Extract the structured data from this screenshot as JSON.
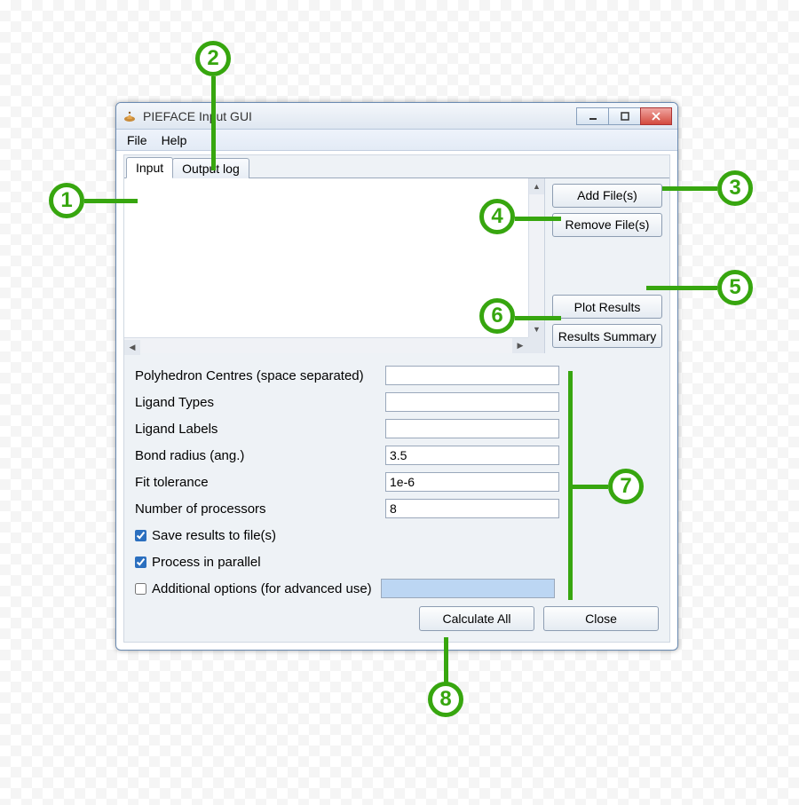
{
  "window": {
    "title": "PIEFACE Input GUI"
  },
  "menubar": {
    "file": "File",
    "help": "Help"
  },
  "tabs": {
    "input": "Input",
    "output_log": "Output log"
  },
  "sidebuttons": {
    "add_files": "Add File(s)",
    "remove_files": "Remove File(s)",
    "plot_results": "Plot Results",
    "results_summary": "Results Summary"
  },
  "form": {
    "poly_centres_label": "Polyhedron Centres (space separated)",
    "poly_centres_value": "",
    "ligand_types_label": "Ligand Types",
    "ligand_types_value": "",
    "ligand_labels_label": "Ligand Labels",
    "ligand_labels_value": "",
    "bond_radius_label": "Bond radius (ang.)",
    "bond_radius_value": "3.5",
    "fit_tol_label": "Fit tolerance",
    "fit_tol_value": "1e-6",
    "num_proc_label": "Number of processors",
    "num_proc_value": "8",
    "save_results_label": "Save results to file(s)",
    "save_results_checked": true,
    "parallel_label": "Process in parallel",
    "parallel_checked": true,
    "advanced_label": "Additional options (for advanced use)",
    "advanced_checked": false,
    "advanced_value": ""
  },
  "bottom": {
    "calculate": "Calculate All",
    "close": "Close"
  },
  "annotations": {
    "1": "1",
    "2": "2",
    "3": "3",
    "4": "4",
    "5": "5",
    "6": "6",
    "7": "7",
    "8": "8"
  }
}
